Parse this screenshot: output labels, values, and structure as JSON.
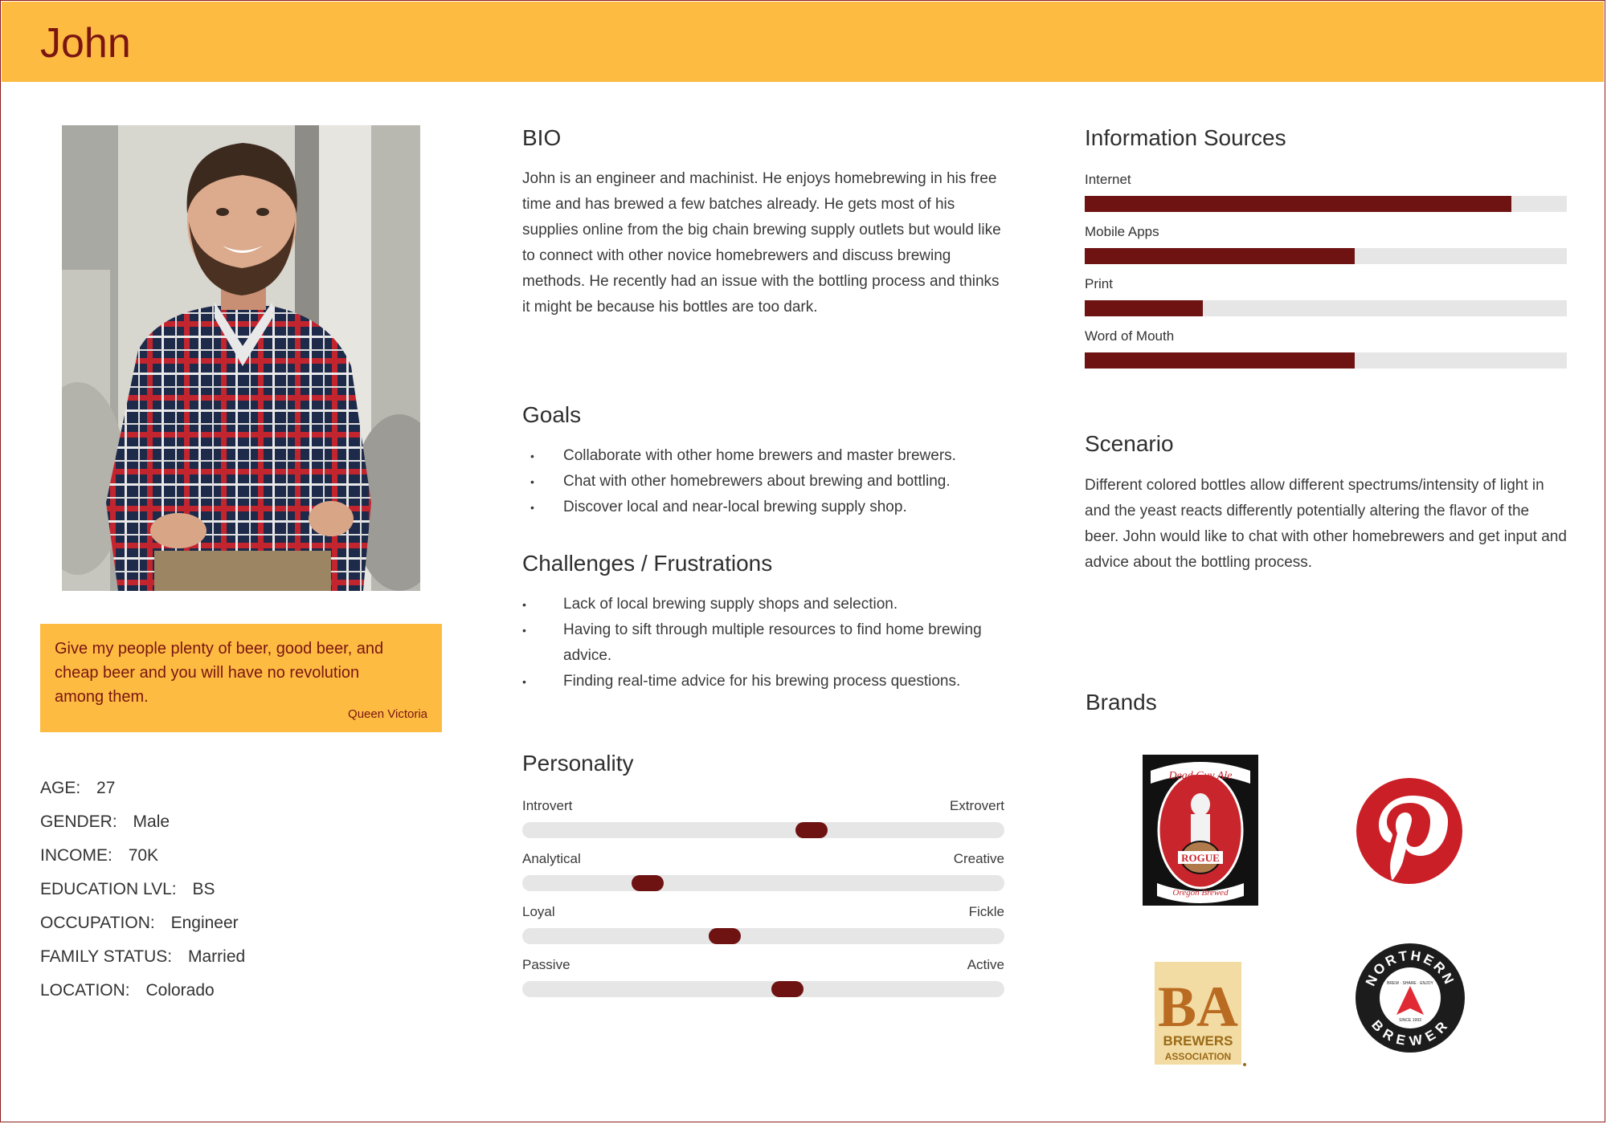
{
  "persona": {
    "name": "John"
  },
  "photo": {
    "alt": "John"
  },
  "quote": {
    "text": "Give my people plenty of beer, good beer, and cheap beer and you will have no revolution among them.",
    "author": "Queen Victoria"
  },
  "demographics": [
    {
      "label": "AGE:",
      "value": "27"
    },
    {
      "label": "GENDER:",
      "value": "Male"
    },
    {
      "label": "INCOME:",
      "value": "70K"
    },
    {
      "label": "EDUCATION LVL:",
      "value": "BS"
    },
    {
      "label": "OCCUPATION:",
      "value": "Engineer"
    },
    {
      "label": "FAMILY STATUS:",
      "value": "Married"
    },
    {
      "label": "LOCATION:",
      "value": "Colorado"
    }
  ],
  "bio": {
    "title": "BIO",
    "text": "John is an engineer and machinist. He enjoys homebrewing in his free time and has brewed a few batches already. He gets most of his supplies online from the big chain brewing supply outlets but would like to connect with other novice homebrewers and discuss brewing methods. He recently had an issue with the bottling process and thinks it might be because his bottles are too dark."
  },
  "goals": {
    "title": "Goals",
    "items": [
      "Collaborate with other home brewers and master brewers.",
      "Chat with other homebrewers about brewing and bottling.",
      "Discover local and near-local brewing supply shop."
    ]
  },
  "challenges": {
    "title": "Challenges / Frustrations",
    "items": [
      "Lack of local brewing supply shops and selection.",
      "Having to sift through multiple resources to find home brewing advice.",
      "Finding real-time advice for his brewing process questions."
    ]
  },
  "personality": {
    "title": "Personality",
    "traits": [
      {
        "left": "Introvert",
        "right": "Extrovert",
        "level": 0.6
      },
      {
        "left": "Analytical",
        "right": "Creative",
        "level": 0.26
      },
      {
        "left": "Loyal",
        "right": "Fickle",
        "level": 0.42
      },
      {
        "left": "Passive",
        "right": "Active",
        "level": 0.55
      }
    ]
  },
  "information_sources": {
    "title": "Information Sources",
    "items": [
      {
        "label": "Internet",
        "level": 0.885
      },
      {
        "label": "Mobile Apps",
        "level": 0.56
      },
      {
        "label": "Print",
        "level": 0.245
      },
      {
        "label": "Word of Mouth",
        "level": 0.56
      }
    ]
  },
  "scenario": {
    "title": "Scenario",
    "text": "Different colored bottles allow different spectrums/intensity of light in and the yeast reacts differently potentially altering the flavor of the beer. John would like to chat with other homebrewers and get input and advice about the bottling process."
  },
  "brands": {
    "title": "Brands",
    "rogue": {
      "top": "Dead Guy Ale",
      "name": "ROGUE",
      "bottom": "Oregon Brewed"
    },
    "pinterest": {
      "name": "Pinterest"
    },
    "brewers_association": {
      "mark": "BA",
      "line1": "BREWERS",
      "line2": "ASSOCIATION"
    },
    "northern_brewer": {
      "top": "NORTHERN",
      "bottom": "BREWER",
      "tagline": "BREW · SHARE · ENJOY",
      "since": "SINCE 1993"
    }
  },
  "colors": {
    "accent": "#fdbb42",
    "primary": "#6e1212",
    "title": "#7a1512",
    "track": "#e6e6e6"
  }
}
